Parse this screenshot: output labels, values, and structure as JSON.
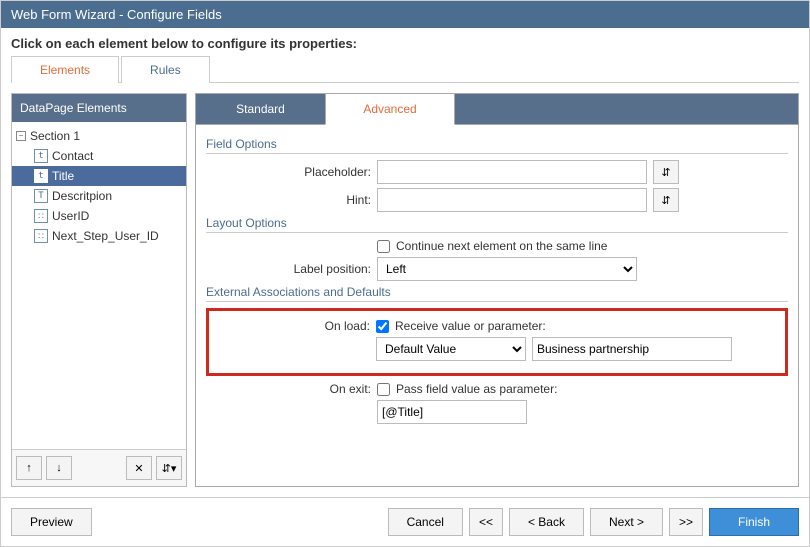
{
  "window": {
    "title": "Web Form Wizard - Configure Fields",
    "instructions": "Click on each element below to configure its properties:"
  },
  "mainTabs": {
    "elements": "Elements",
    "rules": "Rules",
    "active": "elements"
  },
  "sidebar": {
    "header": "DataPage Elements",
    "section": "Section 1",
    "items": [
      {
        "icon": "t",
        "label": "Contact"
      },
      {
        "icon": "t",
        "label": "Title",
        "selected": true
      },
      {
        "icon": "T",
        "label": "Descritpion"
      },
      {
        "icon": "v",
        "label": "UserID"
      },
      {
        "icon": "v",
        "label": "Next_Step_User_ID"
      }
    ],
    "buttons": {
      "up": "↑",
      "down": "↓",
      "delete": "✕",
      "insert": "⇵▾"
    }
  },
  "subTabs": {
    "standard": "Standard",
    "advanced": "Advanced",
    "active": "advanced"
  },
  "config": {
    "fieldOptions": {
      "label": "Field Options",
      "placeholderLabel": "Placeholder:",
      "placeholderValue": "",
      "hintLabel": "Hint:",
      "hintValue": ""
    },
    "layoutOptions": {
      "label": "Layout Options",
      "continueLabel": "Continue next element on the same line",
      "continueChecked": false,
      "labelPositionLabel": "Label position:",
      "labelPositionValue": "Left"
    },
    "externalAssoc": {
      "label": "External Associations and Defaults",
      "onLoadLabel": "On load:",
      "receiveLabel": "Receive value or parameter:",
      "receiveChecked": true,
      "sourceType": "Default Value",
      "sourceValue": "Business partnership",
      "onExitLabel": "On exit:",
      "passLabel": "Pass field value as parameter:",
      "passChecked": false,
      "paramField": "[@Title]"
    }
  },
  "footer": {
    "preview": "Preview",
    "cancel": "Cancel",
    "first": "<<",
    "back": "< Back",
    "next": "Next >",
    "last": ">>",
    "finish": "Finish"
  }
}
